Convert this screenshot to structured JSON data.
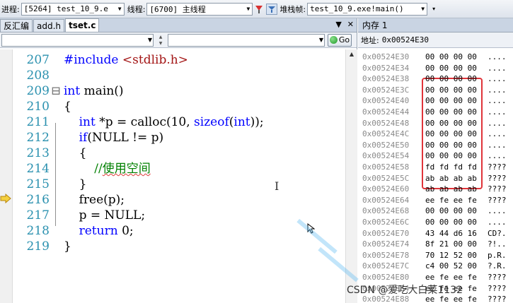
{
  "toolbar": {
    "process_label": "进程:",
    "process_value": "[5264] test_10_9.e",
    "thread_label": "线程:",
    "thread_value": "[6700] 主线程",
    "stack_label": "堆栈帧:",
    "stack_value": "test_10_9.exe!main()"
  },
  "tabs": [
    {
      "label": "反汇编"
    },
    {
      "label": "add.h"
    },
    {
      "label": "tset.c"
    }
  ],
  "navbar": {
    "go_label": "Go"
  },
  "code_lines": [
    {
      "num": "207",
      "parts": [
        {
          "t": "#include ",
          "c": "kw"
        },
        {
          "t": "<stdlib.h>",
          "c": "inc"
        }
      ]
    },
    {
      "num": "208",
      "parts": []
    },
    {
      "num": "209",
      "parts": [
        {
          "t": "int",
          "c": "kw"
        },
        {
          "t": " main()",
          "c": ""
        }
      ]
    },
    {
      "num": "210",
      "parts": [
        {
          "t": "{",
          "c": ""
        }
      ]
    },
    {
      "num": "211",
      "parts": [
        {
          "t": "    ",
          "c": ""
        },
        {
          "t": "int",
          "c": "kw"
        },
        {
          "t": " *p = calloc(10, ",
          "c": ""
        },
        {
          "t": "sizeof",
          "c": "kw"
        },
        {
          "t": "(",
          "c": ""
        },
        {
          "t": "int",
          "c": "kw"
        },
        {
          "t": "));",
          "c": ""
        }
      ]
    },
    {
      "num": "212",
      "parts": [
        {
          "t": "    ",
          "c": ""
        },
        {
          "t": "if",
          "c": "kw"
        },
        {
          "t": "(NULL != p)",
          "c": ""
        }
      ]
    },
    {
      "num": "213",
      "parts": [
        {
          "t": "    {",
          "c": ""
        }
      ]
    },
    {
      "num": "214",
      "parts": [
        {
          "t": "        ",
          "c": ""
        },
        {
          "t": "//",
          "c": "cmt"
        },
        {
          "t": "使用空间",
          "c": "cmt squig"
        }
      ]
    },
    {
      "num": "215",
      "parts": [
        {
          "t": "    }",
          "c": ""
        }
      ]
    },
    {
      "num": "216",
      "parts": [
        {
          "t": "    free(p);",
          "c": ""
        }
      ]
    },
    {
      "num": "217",
      "parts": [
        {
          "t": "    p = NULL;",
          "c": ""
        }
      ]
    },
    {
      "num": "218",
      "parts": [
        {
          "t": "    ",
          "c": ""
        },
        {
          "t": "return",
          "c": "kw"
        },
        {
          "t": " 0;",
          "c": ""
        }
      ]
    },
    {
      "num": "219",
      "parts": [
        {
          "t": "}",
          "c": ""
        }
      ]
    }
  ],
  "memory": {
    "title": "内存 1",
    "address_label": "地址:",
    "address_value": "0x00524E30",
    "rows": [
      {
        "addr": "0x00524E30",
        "bytes": "00 00 00 00",
        "chars": "...."
      },
      {
        "addr": "0x00524E34",
        "bytes": "00 00 00 00",
        "chars": "...."
      },
      {
        "addr": "0x00524E38",
        "bytes": "00 00 00 00",
        "chars": "...."
      },
      {
        "addr": "0x00524E3C",
        "bytes": "00 00 00 00",
        "chars": "...."
      },
      {
        "addr": "0x00524E40",
        "bytes": "00 00 00 00",
        "chars": "...."
      },
      {
        "addr": "0x00524E44",
        "bytes": "00 00 00 00",
        "chars": "...."
      },
      {
        "addr": "0x00524E48",
        "bytes": "00 00 00 00",
        "chars": "...."
      },
      {
        "addr": "0x00524E4C",
        "bytes": "00 00 00 00",
        "chars": "...."
      },
      {
        "addr": "0x00524E50",
        "bytes": "00 00 00 00",
        "chars": "...."
      },
      {
        "addr": "0x00524E54",
        "bytes": "00 00 00 00",
        "chars": "...."
      },
      {
        "addr": "0x00524E58",
        "bytes": "fd fd fd fd",
        "chars": "????"
      },
      {
        "addr": "0x00524E5C",
        "bytes": "ab ab ab ab",
        "chars": "????"
      },
      {
        "addr": "0x00524E60",
        "bytes": "ab ab ab ab",
        "chars": "????"
      },
      {
        "addr": "0x00524E64",
        "bytes": "ee fe ee fe",
        "chars": "????"
      },
      {
        "addr": "0x00524E68",
        "bytes": "00 00 00 00",
        "chars": "...."
      },
      {
        "addr": "0x00524E6C",
        "bytes": "00 00 00 00",
        "chars": "...."
      },
      {
        "addr": "0x00524E70",
        "bytes": "43 44 d6 16",
        "chars": "CD?."
      },
      {
        "addr": "0x00524E74",
        "bytes": "8f 21 00 00",
        "chars": "?!.."
      },
      {
        "addr": "0x00524E78",
        "bytes": "70 12 52 00",
        "chars": "p.R."
      },
      {
        "addr": "0x00524E7C",
        "bytes": "c4 00 52 00",
        "chars": "?.R."
      },
      {
        "addr": "0x00524E80",
        "bytes": "ee fe ee fe",
        "chars": "????"
      },
      {
        "addr": "0x00524E84",
        "bytes": "ee fe ee fe",
        "chars": "????"
      },
      {
        "addr": "0x00524E88",
        "bytes": "ee fe ee fe",
        "chars": "????"
      }
    ]
  },
  "watermark": "CSDN @爱吃大白菜1132"
}
